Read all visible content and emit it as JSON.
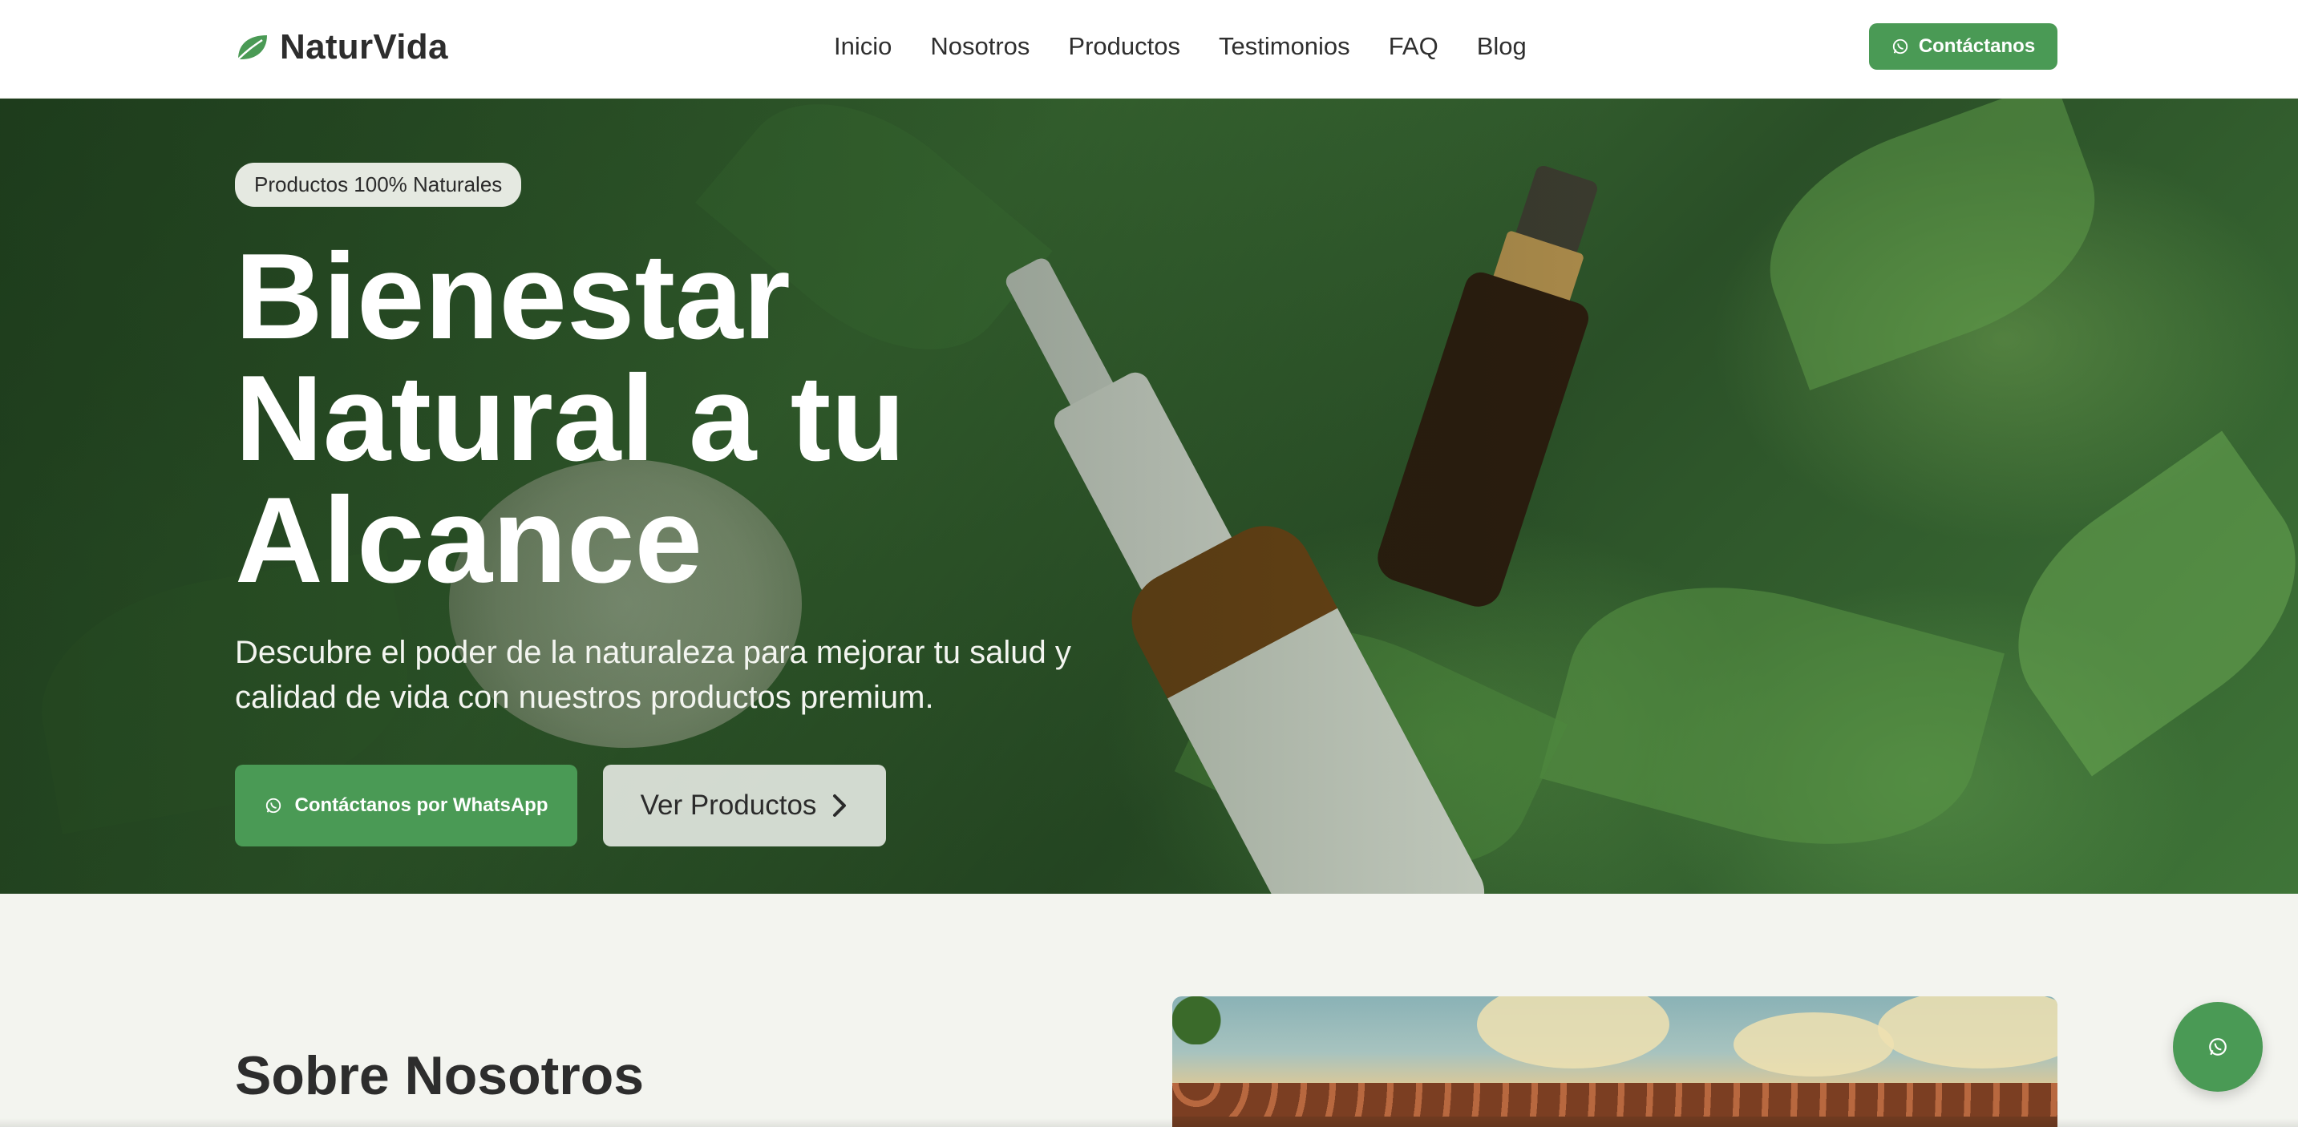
{
  "brand": {
    "name": "NaturVida",
    "icon": "leaf-icon"
  },
  "nav": {
    "items": [
      "Inicio",
      "Nosotros",
      "Productos",
      "Testimonios",
      "FAQ",
      "Blog"
    ]
  },
  "header": {
    "contact_label": "Contáctanos",
    "contact_icon": "whatsapp-icon"
  },
  "hero": {
    "badge": "Productos 100% Naturales",
    "title": "Bienestar Natural a tu Alcance",
    "subtitle": "Descubre el poder de la naturaleza para mejorar tu salud y calidad de vida con nuestros productos premium.",
    "primary_cta": "Contáctanos por WhatsApp",
    "secondary_cta": "Ver Productos",
    "secondary_icon": "chevron-right-icon"
  },
  "about": {
    "title": "Sobre Nosotros"
  },
  "fab": {
    "icon": "whatsapp-icon"
  },
  "colors": {
    "accent": "#4a9a55",
    "text": "#2d2d2d",
    "background": "#f3f4ef"
  }
}
